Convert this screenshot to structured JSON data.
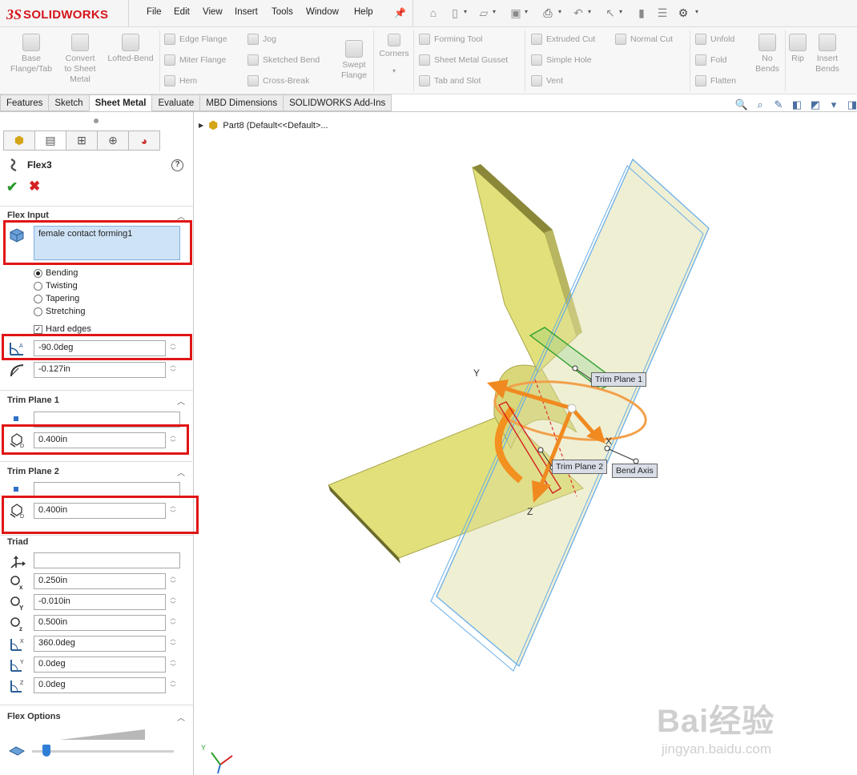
{
  "app": {
    "logo_prefix": "3S",
    "logo_text": "SOLIDWORKS"
  },
  "menu": [
    "File",
    "Edit",
    "View",
    "Insert",
    "Tools",
    "Window",
    "Help"
  ],
  "ribbon": {
    "big_buttons": [
      {
        "label": "Base\nFlange/Tab",
        "icon": "base-flange-icon"
      },
      {
        "label": "Convert\nto Sheet\nMetal",
        "icon": "convert-sheet-metal-icon"
      },
      {
        "label": "Lofted-Bend",
        "icon": "lofted-bend-icon"
      }
    ],
    "group1": [
      "Edge Flange",
      "Miter Flange",
      "Hem"
    ],
    "group2": [
      "Jog",
      "Sketched Bend",
      "Cross-Break"
    ],
    "swept_flange": "Swept\nFlange",
    "corners": "Corners",
    "group3": [
      "Forming Tool",
      "Sheet Metal Gusset",
      "Tab and Slot"
    ],
    "group4": [
      "Extruded Cut",
      "Simple Hole",
      "Vent"
    ],
    "normal_cut": "Normal Cut",
    "group5": [
      "Unfold",
      "Fold",
      "Flatten"
    ],
    "no_bends": "No\nBends",
    "rip": "Rip",
    "insert_bends": "Insert\nBends"
  },
  "command_tabs": [
    "Features",
    "Sketch",
    "Sheet Metal",
    "Evaluate",
    "MBD Dimensions",
    "SOLIDWORKS Add-Ins"
  ],
  "active_tab": "Sheet Metal",
  "tree": {
    "item": "Part8  (Default<<Default>..."
  },
  "property_manager": {
    "title": "Flex3",
    "flex_input": {
      "header": "Flex Input",
      "selection": "female contact forming1",
      "modes": [
        "Bending",
        "Twisting",
        "Tapering",
        "Stretching"
      ],
      "selected_mode": "Bending",
      "hard_edges_label": "Hard edges",
      "hard_edges_checked": true,
      "angle": "-90.0deg",
      "radius": "-0.127in"
    },
    "trim_plane_1": {
      "header": "Trim Plane 1",
      "value": "",
      "distance": "0.400in"
    },
    "trim_plane_2": {
      "header": "Trim Plane 2",
      "value": "",
      "distance": "0.400in"
    },
    "triad": {
      "header": "Triad",
      "value": "",
      "x": "0.250in",
      "y": "-0.010in",
      "z": "0.500in",
      "rot_x": "360.0deg",
      "rot_y": "0.0deg",
      "rot_z": "0.0deg"
    },
    "flex_options": {
      "header": "Flex Options",
      "accuracy": 0.1
    }
  },
  "viewport": {
    "callouts": {
      "trim1": "Trim Plane 1",
      "trim2": "Trim Plane 2",
      "bend_axis": "Bend Axis"
    },
    "axes": {
      "x": "X",
      "y": "Y",
      "z": "Z"
    },
    "triad_y": "Y"
  },
  "watermark": {
    "main": "Bai经验",
    "sub": "jingyan.baidu.com"
  },
  "colors": {
    "brand": "#d4141b",
    "highlight": "#e01515",
    "part": "#e2e07a",
    "accent": "#2f6fc8"
  }
}
